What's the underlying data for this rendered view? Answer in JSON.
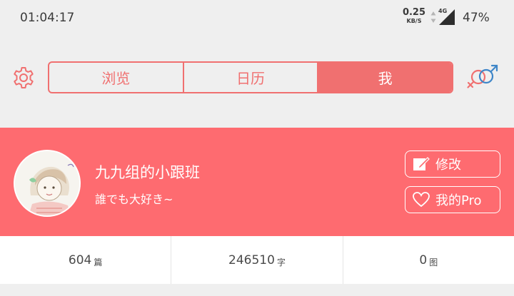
{
  "status_bar": {
    "time": "01:04:17",
    "net_speed_value": "0.25",
    "net_speed_unit": "KB/S",
    "network_type": "4G",
    "battery": "47%"
  },
  "toolbar": {
    "settings_icon": "gear-icon",
    "tabs": [
      {
        "label": "浏览",
        "active": false
      },
      {
        "label": "日历",
        "active": false
      },
      {
        "label": "我",
        "active": true
      }
    ],
    "gender_icon": "gender-symbols-icon"
  },
  "profile": {
    "username": "九九组的小跟班",
    "motto": "誰でも大好き~",
    "edit_label": "修改",
    "pro_label": "我的Pro"
  },
  "stats": [
    {
      "value": "604",
      "unit": "篇"
    },
    {
      "value": "246510",
      "unit": "字"
    },
    {
      "value": "0",
      "unit": "图"
    }
  ],
  "colors": {
    "accent": "#f07070",
    "banner": "#fe6b70",
    "background": "#efefef"
  }
}
